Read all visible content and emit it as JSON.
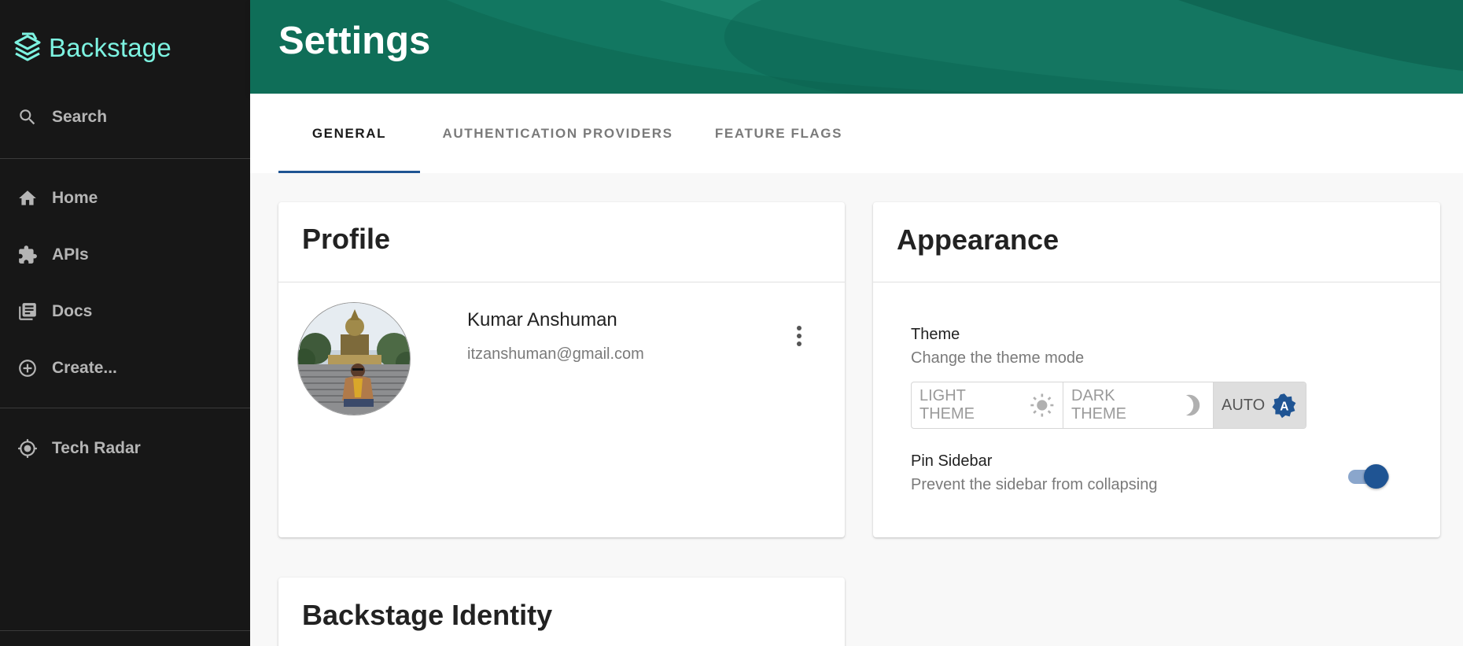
{
  "brand": {
    "name": "Backstage",
    "accent": "#7df3e1"
  },
  "sidebar": {
    "search_label": "Search",
    "items": [
      {
        "label": "Home",
        "icon": "home-icon"
      },
      {
        "label": "APIs",
        "icon": "puzzle-icon"
      },
      {
        "label": "Docs",
        "icon": "library-books-icon"
      },
      {
        "label": "Create...",
        "icon": "add-circle-icon"
      }
    ],
    "extra_items": [
      {
        "label": "Tech Radar",
        "icon": "gps-fixed-icon"
      }
    ]
  },
  "header": {
    "title": "Settings",
    "color": "#0f6e58"
  },
  "tabs": [
    {
      "label": "GENERAL",
      "active": true
    },
    {
      "label": "AUTHENTICATION PROVIDERS",
      "active": false
    },
    {
      "label": "FEATURE FLAGS",
      "active": false
    }
  ],
  "profile": {
    "title": "Profile",
    "name": "Kumar Anshuman",
    "email": "itzanshuman@gmail.com",
    "menu_icon": "more-vert-icon"
  },
  "appearance": {
    "title": "Appearance",
    "theme_label": "Theme",
    "theme_desc": "Change the theme mode",
    "theme_options": [
      {
        "label": "LIGHT THEME",
        "icon": "sun-icon",
        "selected": false
      },
      {
        "label": "DARK THEME",
        "icon": "moon-icon",
        "selected": false
      },
      {
        "label": "AUTO",
        "icon": "auto-mode-icon",
        "selected": true
      }
    ],
    "pin_label": "Pin Sidebar",
    "pin_desc": "Prevent the sidebar from collapsing",
    "pin_enabled": true
  },
  "identity": {
    "title": "Backstage Identity"
  }
}
